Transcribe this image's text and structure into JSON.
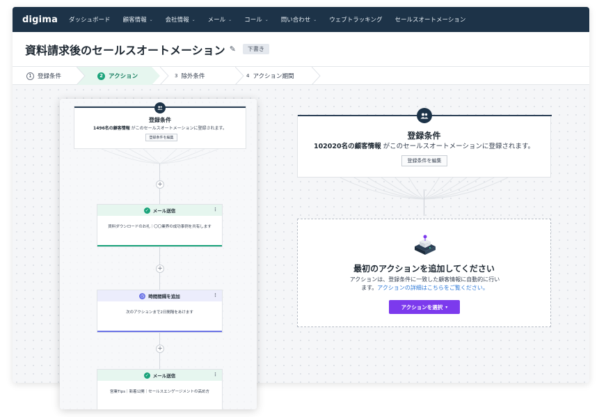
{
  "nav": {
    "logo": "digima",
    "items": [
      {
        "label": "ダッシュボード",
        "dropdown": false
      },
      {
        "label": "顧客情報",
        "dropdown": true
      },
      {
        "label": "会社情報",
        "dropdown": true
      },
      {
        "label": "メール",
        "dropdown": true
      },
      {
        "label": "コール",
        "dropdown": true
      },
      {
        "label": "問い合わせ",
        "dropdown": true
      },
      {
        "label": "ウェブトラッキング",
        "dropdown": false
      },
      {
        "label": "セールスオートメーション",
        "dropdown": false
      }
    ]
  },
  "header": {
    "title": "資料請求後のセールスオートメーション",
    "edit_icon": "pencil-icon",
    "badge": "下書き"
  },
  "steps": [
    {
      "num": "1",
      "label": "登録条件",
      "active": false
    },
    {
      "num": "2",
      "label": "アクション",
      "active": true
    },
    {
      "num": "3",
      "label": "除外条件",
      "active": false
    },
    {
      "num": "4",
      "label": "アクション期間",
      "active": false
    }
  ],
  "preview": {
    "registration": {
      "title": "登録条件",
      "count": "1496名の顧客情報",
      "desc": "がこのセールスオートメーションに登録されます。",
      "button": "登録条件を編集"
    },
    "cards": [
      {
        "title": "メール送信",
        "body": "資料ダウンロードのお礼｜〇〇業界の成功事例を共有します",
        "color": "#1aa37a",
        "bg": "#e6f6ef"
      },
      {
        "title": "時間間隔を追加",
        "body": "次のアクションまで2日間隔をあけます",
        "color": "#6a72e6",
        "bg": "#ecedfc"
      },
      {
        "title": "メール送信",
        "body": "営業Tips｜新着公開｜セールスエンゲージメントの高め方",
        "color": "#1aa37a",
        "bg": "#e6f6ef"
      }
    ],
    "plus": "+"
  },
  "registration": {
    "title": "登録条件",
    "count": "102020名の顧客情報",
    "desc": "がこのセールスオートメーションに登録されます。",
    "button": "登録条件を編集",
    "icon": "users-icon"
  },
  "action": {
    "title": "最初のアクションを追加してください",
    "desc_line1": "アクションは、登録条件に一致した顧客情報に自動的に行い",
    "desc_line2_prefix": "ます。",
    "desc_link": "アクションの詳細はこちらをご覧ください。",
    "button": "アクションを選択",
    "button_color": "#7c3aed"
  }
}
